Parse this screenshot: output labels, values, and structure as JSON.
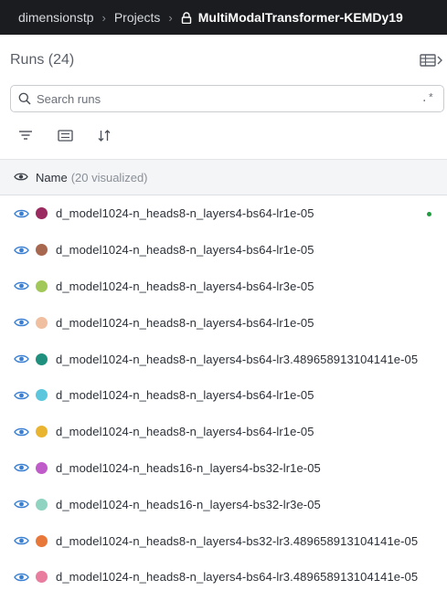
{
  "breadcrumb": {
    "entity": "dimensionstp",
    "section": "Projects",
    "project": "MultiModalTransformer-KEMDy19"
  },
  "runs_panel": {
    "title": "Runs (24)",
    "search_placeholder": "Search runs",
    "regex_label": ".*"
  },
  "columns": {
    "name_label": "Name",
    "visualized_label": "(20 visualized)"
  },
  "runs": [
    {
      "name": "d_model1024-n_heads8-n_layers4-bs64-lr1e-05",
      "color": "#9a2a5f",
      "live": true
    },
    {
      "name": "d_model1024-n_heads8-n_layers4-bs64-lr1e-05",
      "color": "#a8674f",
      "live": false
    },
    {
      "name": "d_model1024-n_heads8-n_layers4-bs64-lr3e-05",
      "color": "#a3c85a",
      "live": false
    },
    {
      "name": "d_model1024-n_heads8-n_layers4-bs64-lr1e-05",
      "color": "#f0bfa0",
      "live": false
    },
    {
      "name": "d_model1024-n_heads8-n_layers4-bs64-lr3.489658913104141e-05",
      "color": "#1f8f7e",
      "live": false
    },
    {
      "name": "d_model1024-n_heads8-n_layers4-bs64-lr1e-05",
      "color": "#5cc6dc",
      "live": false
    },
    {
      "name": "d_model1024-n_heads8-n_layers4-bs64-lr1e-05",
      "color": "#e9b531",
      "live": false
    },
    {
      "name": "d_model1024-n_heads16-n_layers4-bs32-lr1e-05",
      "color": "#c05cc9",
      "live": false
    },
    {
      "name": "d_model1024-n_heads16-n_layers4-bs32-lr3e-05",
      "color": "#8fd3c0",
      "live": false
    },
    {
      "name": "d_model1024-n_heads8-n_layers4-bs32-lr3.489658913104141e-05",
      "color": "#e8773a",
      "live": false
    },
    {
      "name": "d_model1024-n_heads8-n_layers4-bs64-lr3.489658913104141e-05",
      "color": "#e97d9f",
      "live": false
    }
  ],
  "colors": {
    "topbar": "#1a1c1f",
    "eye_icon": "#3a7fd1",
    "live_indicator": "#1f9d3f"
  },
  "icons": [
    "lock-icon",
    "table-toggle-icon",
    "search-icon",
    "filter-icon",
    "group-icon",
    "sort-icon",
    "eye-icon"
  ]
}
